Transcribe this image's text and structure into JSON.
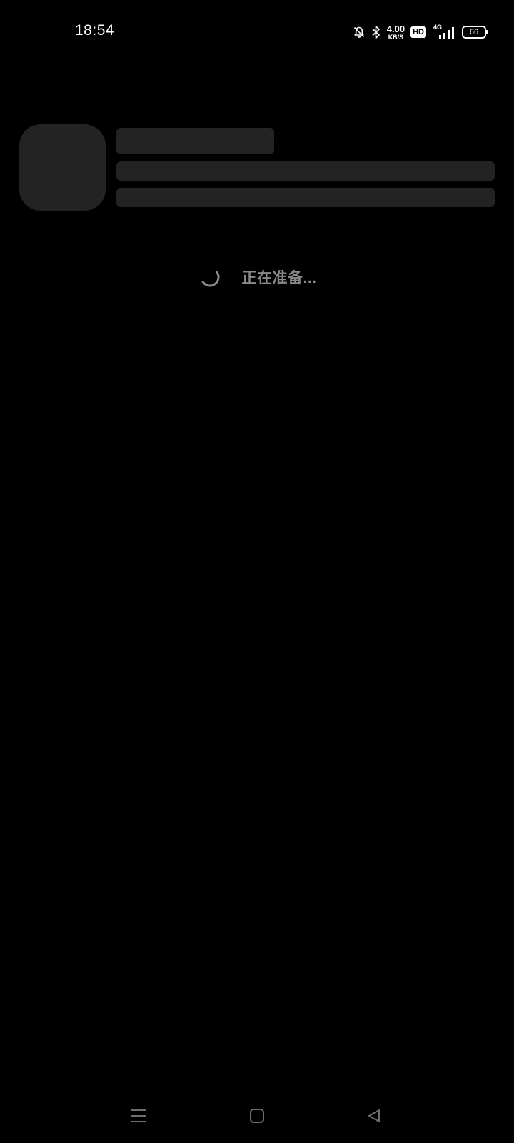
{
  "status_bar": {
    "time": "18:54",
    "net_speed_value": "4.00",
    "net_speed_unit": "KB/S",
    "hd_label": "HD",
    "network_type": "4G",
    "battery_level": "66",
    "icons": [
      "bell-off-icon",
      "bluetooth-icon",
      "signal-icon",
      "battery-icon"
    ]
  },
  "loading": {
    "text": "正在准备..."
  },
  "nav_bar": {
    "icons": [
      "menu-icon",
      "home-icon",
      "back-icon"
    ]
  },
  "colors": {
    "background": "#000000",
    "skeleton": "#232323",
    "loading_text": "#8a8a8a",
    "nav_icon": "#6e6e6e",
    "status_icon": "#ffffff"
  }
}
